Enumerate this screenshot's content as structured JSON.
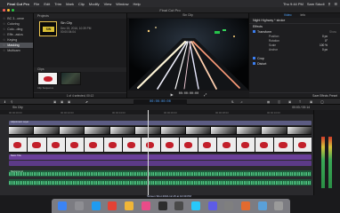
{
  "menubar": {
    "app": "Final Cut Pro",
    "items": [
      "File",
      "Edit",
      "Trim",
      "Mark",
      "Clip",
      "Modify",
      "View",
      "Window",
      "Help"
    ],
    "right": [
      "Thu 9:44 PM",
      "Sam Sdudi"
    ]
  },
  "window": {
    "title": "Final Cut Pro"
  },
  "libraries": {
    "rows": [
      {
        "label": "BC 3...cene",
        "selected": false
      },
      {
        "label": "Coloring",
        "selected": false
      },
      {
        "label": "Colo...ding",
        "selected": false
      },
      {
        "label": "Effe...asics",
        "selected": false
      },
      {
        "label": "Keying",
        "selected": false
      },
      {
        "label": "Masking",
        "selected": true
      },
      {
        "label": "Multicam",
        "selected": false
      }
    ]
  },
  "browser": {
    "projects_header": "Projects",
    "project": {
      "name": "Sin City",
      "date": "Dec 15, 2016, 10:39 PM",
      "info": "00:00:04:04",
      "thumb_text": "SIN CITY"
    },
    "clips_header": "Clips",
    "clips": [
      {
        "label": "",
        "type": "red"
      },
      {
        "label": "",
        "type": "dark"
      }
    ],
    "clip_caption": "Clip Sequence",
    "status": "1 of 4 selected, 00:12"
  },
  "viewer": {
    "header": "Sin City",
    "timecode": "00:00:00:00",
    "zoom": "59%",
    "view": "View"
  },
  "inspector": {
    "tabs": [
      {
        "label": "Video",
        "selected": true
      },
      {
        "label": "Info",
        "selected": false
      }
    ],
    "clip_title": "Night Highway * stroke",
    "sections": [
      {
        "label": "Effects",
        "has_check": false
      },
      {
        "label": "Transform",
        "has_check": true
      }
    ],
    "params": [
      {
        "label": "Position",
        "value": "0 px"
      },
      {
        "label": "Rotation",
        "value": "0°"
      },
      {
        "label": "Scale",
        "value": "100 %"
      },
      {
        "label": "Anchor",
        "value": "0 px"
      }
    ],
    "sections2": [
      {
        "label": "Crop",
        "has_check": true
      },
      {
        "label": "Distort",
        "has_check": true
      }
    ],
    "show_label": "Show",
    "status": "Save Effects Preset"
  },
  "toolbar": {
    "timecode": "00:00:00:00",
    "timeline_title": "Sin City",
    "range": "00:03 / 00:14"
  },
  "timeline": {
    "ruler_ticks": [
      "00:00:00:00",
      "00:00:02:00",
      "00:00:04:00",
      "00:00:06:00",
      "00:00:08:00",
      "00:00:10:00"
    ],
    "fx_label": "Adjustment Layer",
    "title_label": "Basic Title",
    "audio_label": "Background"
  },
  "dock": {
    "status": "Screen Shot 2016-12-15 at 10:39 PM"
  },
  "colors": {
    "accent": "#4fa5ff",
    "title_clip": "#6a3f99",
    "fx_clip": "#5b5b82",
    "audio_clip": "#1e5a3a",
    "selection": "#eac34f"
  }
}
